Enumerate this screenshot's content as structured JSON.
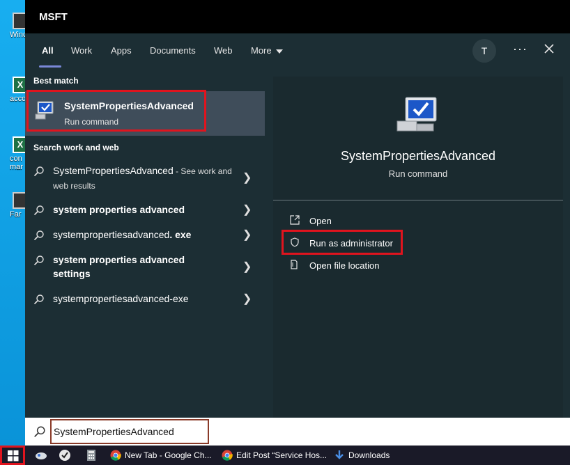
{
  "window_title": "MSFT",
  "tabs": [
    {
      "label": "All"
    },
    {
      "label": "Work"
    },
    {
      "label": "Apps"
    },
    {
      "label": "Documents"
    },
    {
      "label": "Web"
    },
    {
      "label": "More"
    }
  ],
  "avatar_initial": "T",
  "more_options": "···",
  "left": {
    "best_match_heading": "Best match",
    "best_match": {
      "title": "SystemPropertiesAdvanced",
      "subtitle": "Run command",
      "icon": "system-properties-icon"
    },
    "web_heading": "Search work and web",
    "results": [
      {
        "text": "SystemPropertiesAdvanced",
        "suffix": " - See work and web results"
      },
      {
        "text": "system properties advanced"
      },
      {
        "text": "systempropertiesadvanced",
        "bold_part": ". exe"
      },
      {
        "text": "system properties advanced settings"
      },
      {
        "text": "systempropertiesadvanced-exe"
      }
    ]
  },
  "right": {
    "title": "SystemPropertiesAdvanced",
    "subtitle": "Run command",
    "actions": [
      {
        "label": "Open",
        "icon": "open-icon"
      },
      {
        "label": "Run as administrator",
        "icon": "shield-icon"
      },
      {
        "label": "Open file location",
        "icon": "folder-icon"
      }
    ]
  },
  "search": {
    "value": "SystemPropertiesAdvanced"
  },
  "desktop_icons": [
    {
      "label": "Wind"
    },
    {
      "label": "acco"
    },
    {
      "label": "con"
    },
    {
      "label": "mar"
    },
    {
      "label": "Far"
    }
  ],
  "taskbar": {
    "items": [
      {
        "label": "New Tab - Google Ch..."
      },
      {
        "label": "Edit Post “Service Hos..."
      },
      {
        "label": "Downloads"
      }
    ]
  },
  "colors": {
    "highlight_border": "#e0141e",
    "panel_bg": "#1c2e34",
    "accent": "#7a88d8"
  }
}
